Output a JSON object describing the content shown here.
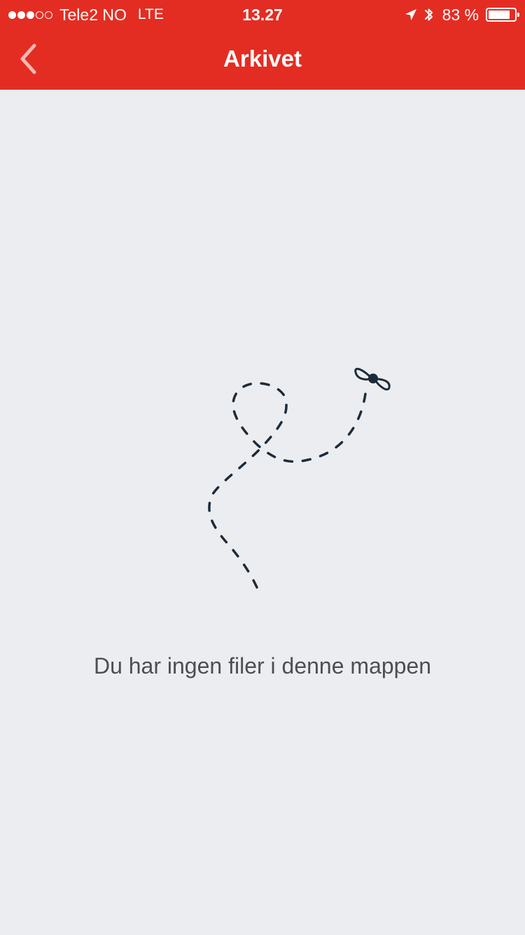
{
  "status_bar": {
    "signal_dots": [
      true,
      true,
      true,
      false,
      false
    ],
    "carrier": "Tele2 NO",
    "network": "LTE",
    "time": "13.27",
    "battery_percent": "83 %",
    "battery_level": 0.83,
    "icons": [
      "location-arrow-icon",
      "bluetooth-icon",
      "battery-icon"
    ]
  },
  "nav": {
    "title": "Arkivet",
    "back_icon": "chevron-left-icon"
  },
  "empty_state": {
    "illustration": "dashed-flight-path-bow-icon",
    "message": "Du har ingen filer i denne mappen"
  },
  "colors": {
    "header": "#e42d22",
    "background": "#ecedf0",
    "illustration_stroke": "#1c2b3a",
    "message_text": "#4b4f55"
  }
}
